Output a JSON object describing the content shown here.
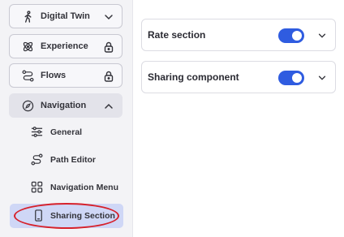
{
  "sidebar": {
    "items": [
      {
        "label": "Digital Twin",
        "icon": "walking-person-icon",
        "end": "chevron-down-icon"
      },
      {
        "label": "Experience",
        "icon": "atom-icon",
        "end": "lock-icon"
      },
      {
        "label": "Flows",
        "icon": "flow-icon",
        "end": "lock-icon"
      },
      {
        "label": "Navigation",
        "icon": "compass-icon",
        "end": "chevron-up-icon"
      }
    ],
    "subitems": [
      {
        "label": "General",
        "icon": "sliders-icon"
      },
      {
        "label": "Path Editor",
        "icon": "path-icon"
      },
      {
        "label": "Navigation Menu",
        "icon": "grid-icon"
      },
      {
        "label": "Sharing Section",
        "icon": "phone-icon"
      }
    ]
  },
  "main": {
    "cards": [
      {
        "title": "Rate section",
        "toggle_on": true
      },
      {
        "title": "Sharing component",
        "toggle_on": true
      }
    ]
  },
  "colors": {
    "accent": "#2f5ce0",
    "selected_bg": "#cfd7f6",
    "highlight": "#d6212b"
  }
}
